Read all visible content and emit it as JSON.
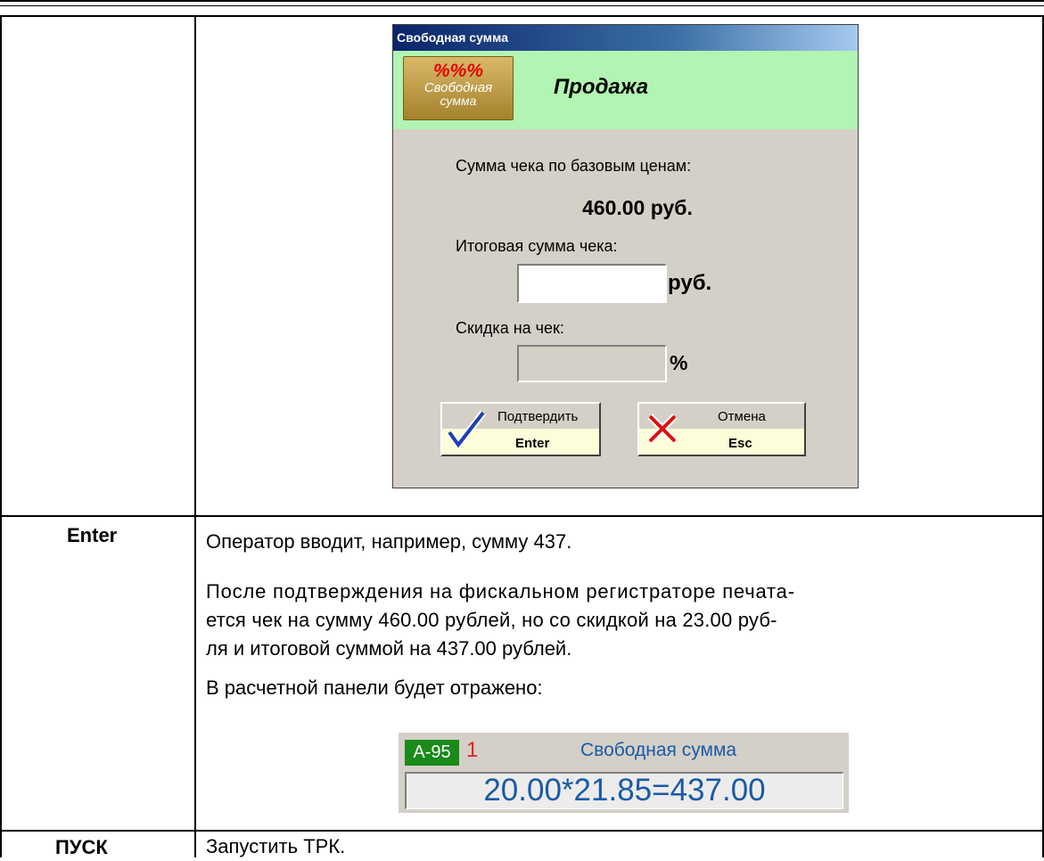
{
  "dialog": {
    "title": "Свободная сумма",
    "badge": {
      "percent": "%%%",
      "line1": "Свободная",
      "line2": "сумма"
    },
    "mode": "Продажа",
    "base_label": "Сумма чека по базовым ценам:",
    "base_value": "460.00 руб.",
    "total_label": "Итоговая сумма чека:",
    "total_value": "",
    "total_unit": "руб.",
    "discount_label": "Скидка на чек:",
    "discount_value": "",
    "discount_unit": "%",
    "confirm": {
      "label": "Подтвердить",
      "key": "Enter"
    },
    "cancel": {
      "label": "Отмена",
      "key": "Esc"
    },
    "colors": {
      "header": "#b2f4b2",
      "body": "#d4d0c8"
    }
  },
  "rows": [
    {
      "key": "Enter",
      "lines": [
        "Оператор вводит, например, сумму 437.",
        "После подтверждения на фискальном регистраторе печата-",
        "ется чек на сумму 460.00 рублей, но со скидкой на 23.00 руб-",
        "ля и итоговой суммой на 437.00 рублей.",
        "В расчетной панели будет отражено:"
      ]
    },
    {
      "key": "ПУСК",
      "lines": [
        "Запустить ТРК."
      ]
    }
  ],
  "panel": {
    "fuel": "А-95",
    "pump": "1",
    "name": "Свободная сумма",
    "calc": "20.00*21.85=437.00"
  }
}
